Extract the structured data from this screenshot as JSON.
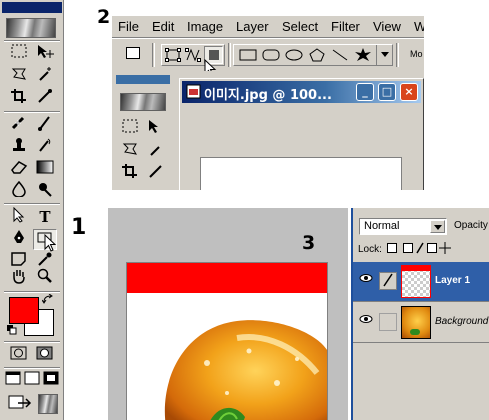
{
  "labels": {
    "step1": "1",
    "step2": "2",
    "step3": "3"
  },
  "menu": {
    "items": [
      "File",
      "Edit",
      "Image",
      "Layer",
      "Select",
      "Filter",
      "View",
      "W"
    ]
  },
  "options_bar": {
    "overflow_label": "Mo"
  },
  "document": {
    "title": "이미지.jpg @ 100...",
    "minimize": "_",
    "maximize": "□",
    "close": "×"
  },
  "toolbox": {
    "tools": [
      {
        "name": "marquee-tool",
        "glyph": "⬚"
      },
      {
        "name": "move-tool",
        "glyph": "▸✥"
      },
      {
        "name": "lasso-tool",
        "glyph": "ℓ"
      },
      {
        "name": "magic-wand-tool",
        "glyph": "⁂"
      },
      {
        "name": "crop-tool",
        "glyph": "⌗"
      },
      {
        "name": "slice-tool",
        "glyph": "⁄"
      },
      {
        "name": "healing-brush-tool",
        "glyph": "✚"
      },
      {
        "name": "brush-tool",
        "glyph": "✎"
      },
      {
        "name": "stamp-tool",
        "glyph": "⚲"
      },
      {
        "name": "history-brush-tool",
        "glyph": "♒"
      },
      {
        "name": "eraser-tool",
        "glyph": "◇"
      },
      {
        "name": "gradient-tool",
        "glyph": "▬"
      },
      {
        "name": "blur-tool",
        "glyph": "💧"
      },
      {
        "name": "dodge-tool",
        "glyph": "●"
      },
      {
        "name": "path-selection-tool",
        "glyph": "↖"
      },
      {
        "name": "type-tool",
        "glyph": "T"
      },
      {
        "name": "pen-tool",
        "glyph": "✒"
      },
      {
        "name": "shape-tool",
        "glyph": "▭"
      },
      {
        "name": "notes-tool",
        "glyph": "▤"
      },
      {
        "name": "eyedropper-tool",
        "glyph": "⁄"
      },
      {
        "name": "hand-tool",
        "glyph": "✋"
      },
      {
        "name": "zoom-tool",
        "glyph": "🔍"
      }
    ],
    "foreground_color": "#ff0000",
    "background_color": "#ffffff"
  },
  "layers": {
    "blend_mode": "Normal",
    "opacity_label": "Opacity",
    "lock_label": "Lock:",
    "rows": [
      {
        "name": "Layer 1",
        "active": true
      },
      {
        "name": "Background",
        "active": false
      }
    ]
  },
  "colors": {
    "title_bar": "#0a246a",
    "chrome": "#d4d0c8",
    "accent_red": "#ff0000",
    "layer_highlight": "#2f5fa8"
  }
}
